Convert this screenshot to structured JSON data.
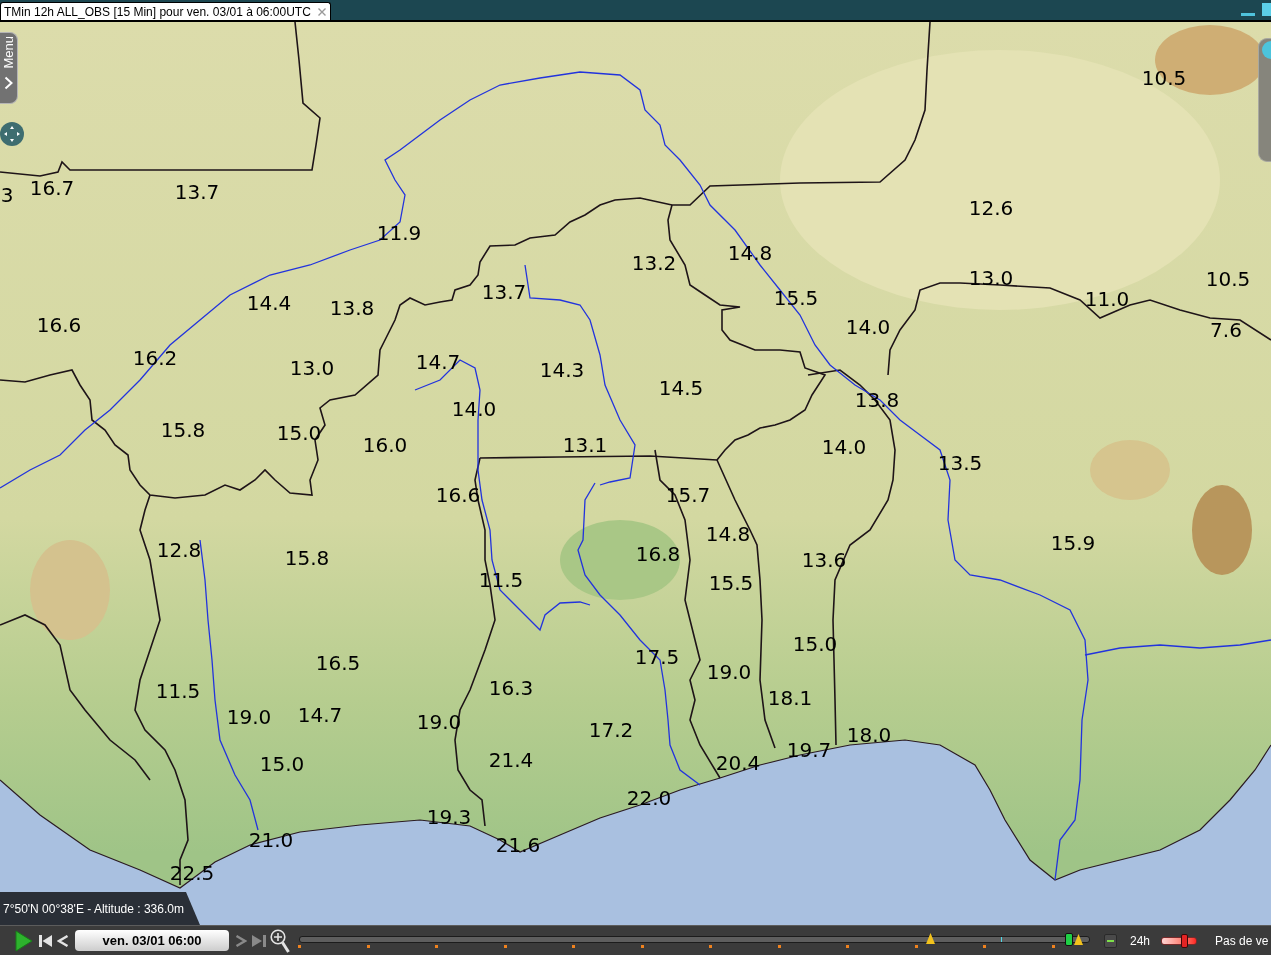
{
  "tabs": [
    {
      "label": "TMin 12h ALL_OBS [15 Min] pour ven. 03/01 à 06:00UTC",
      "selected": true
    }
  ],
  "side_menu": {
    "label": "Menu"
  },
  "map": {
    "observations": [
      "10.5",
      "3",
      "16.7",
      "13.7",
      "12.6",
      "11.9",
      "13.2",
      "14.8",
      "13.0",
      "10.5",
      "14.4",
      "13.8",
      "13.7",
      "15.5",
      "11.0",
      "16.6",
      "14.0",
      "7.6",
      "16.2",
      "13.0",
      "14.7",
      "14.3",
      "14.5",
      "14.0",
      "13.8",
      "15.8",
      "15.0",
      "16.0",
      "13.1",
      "14.0",
      "13.5",
      "16.6",
      "15.7",
      "12.8",
      "15.8",
      "16.8",
      "14.8",
      "13.6",
      "15.9",
      "11.5",
      "15.5",
      "16.5",
      "17.5",
      "19.0",
      "15.0",
      "11.5",
      "16.3",
      "18.1",
      "19.0",
      "14.7",
      "19.0",
      "17.2",
      "18.0",
      "15.0",
      "21.4",
      "20.4",
      "19.7",
      "22.0",
      "19.3",
      "21.0",
      "21.6",
      "22.5"
    ]
  },
  "coordinates": "7°50'N 00°38'E - Altitude : 336.0m",
  "player": {
    "controls": [
      {
        "kind": "play",
        "disabled": false
      },
      {
        "kind": "first",
        "disabled": false
      },
      {
        "kind": "previous",
        "disabled": false
      },
      {
        "kind": "date",
        "label": "ven. 03/01 06:00",
        "disabled": false
      },
      {
        "kind": "next",
        "disabled": true
      },
      {
        "kind": "last",
        "disabled": true
      },
      {
        "kind": "zoom",
        "disabled": false
      }
    ],
    "timeline": {
      "level": 0.974
    },
    "range": {
      "label": "24h",
      "level": 0.66
    },
    "step_label": "Pas de ve"
  }
}
